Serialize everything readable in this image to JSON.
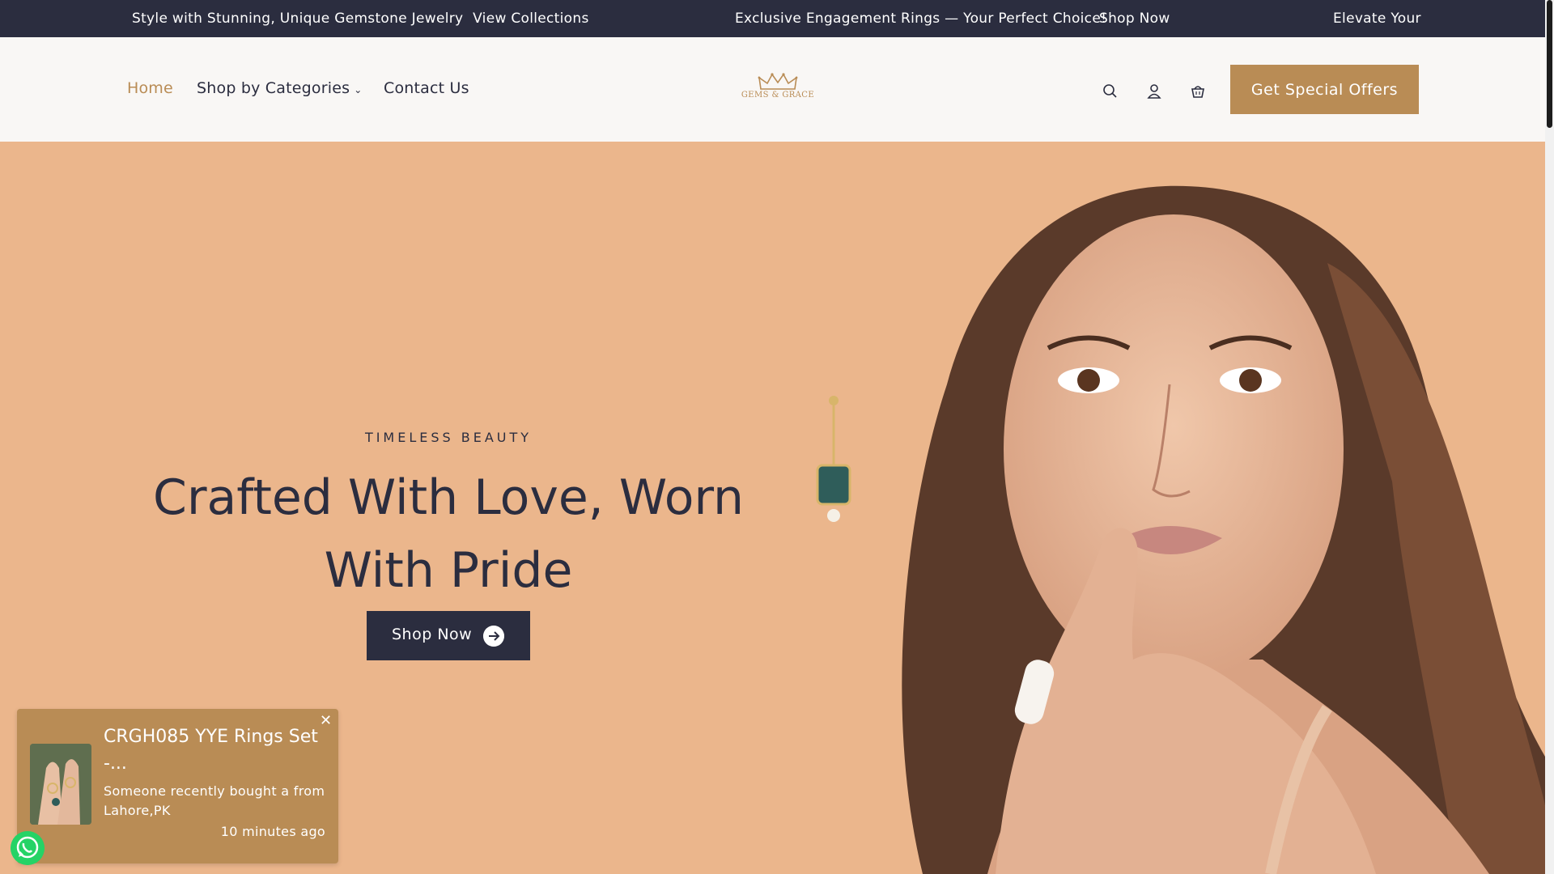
{
  "announcement": {
    "items": [
      {
        "text": "Style with Stunning, Unique Gemstone Jewelry",
        "link": "View Collections"
      },
      {
        "text": "Exclusive Engagement Rings — Your Perfect Choice!",
        "link": "Shop Now"
      },
      {
        "text": "Elevate Your"
      }
    ]
  },
  "nav": {
    "home": "Home",
    "categories": "Shop by Categories",
    "contact": "Contact Us"
  },
  "logo": {
    "text": "GEMS & GRACE"
  },
  "header": {
    "icons": [
      "search-icon",
      "account-icon",
      "cart-icon"
    ],
    "offers_button": "Get Special Offers"
  },
  "hero": {
    "eyebrow": "TIMELESS BEAUTY",
    "headline": "Crafted With Love, Worn With Pride",
    "button": "Shop Now"
  },
  "toast": {
    "title": "CRGH085 YYE Rings Set -...",
    "description": "Someone recently bought a from Lahore,PK",
    "time": "10 minutes ago"
  },
  "colors": {
    "brand_dark": "#2b2d3f",
    "accent_gold": "#b98c55",
    "hero_bg": "#ebb68c",
    "header_bg": "#f9f7f5"
  }
}
